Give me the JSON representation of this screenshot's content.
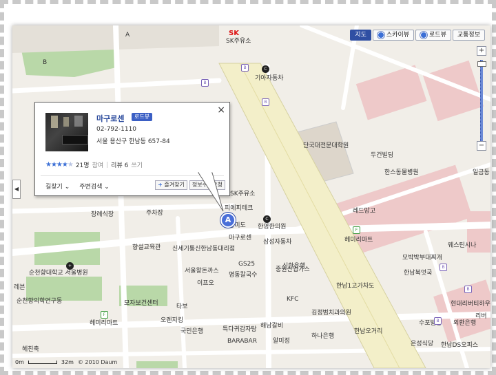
{
  "map_controls": {
    "types": [
      {
        "label": "지도",
        "active": true
      },
      {
        "label": "스카이뷰",
        "active": false
      },
      {
        "label": "로드뷰",
        "active": false
      },
      {
        "label": "교통정보",
        "active": false
      }
    ],
    "zoom_in": "+",
    "zoom_out": "−",
    "collapse": "◀"
  },
  "labels": {
    "sk_brand": "SK",
    "sk_station": "SK주유소",
    "giasa": "기아자동차",
    "dancity": "단국대전문대학원",
    "dugeon": "두건빌딩",
    "hanso": "한스동물병원",
    "ilgeum": "일금동",
    "redmango": "레드망고",
    "hemirimart1": "헤미리마트",
    "wellstina": "웨스틴시나",
    "mobakbag": "모박박부대찌개",
    "hannambook": "한남북엇국",
    "hyundai": "현대리버티하우",
    "riber": "리버",
    "supo": "수포빌딩",
    "oeun": "외환은행",
    "hannamds": "한남DS오피스",
    "eunseong": "은성식당",
    "hannam1": "한남1고가차도",
    "hannamoh": "한남오거리",
    "kimjeong": "김정범치과의원",
    "kfc": "KFC",
    "hanabank": "하나은행",
    "haenam": "해남갈비",
    "almi": "알미정",
    "barabar": "BARABAR",
    "taekwon": "특다귀감자탕",
    "kookmin": "국민은행",
    "ohnsijing": "오렌지킹",
    "tabi": "타보",
    "mojabo": "모자보건센터",
    "hemirimart2": "헤미리마트",
    "suncheon": "순천향대학교 서울병원",
    "suncheon2": "순천향의학연구동",
    "ribbon": "레븐",
    "haechu": "헤친축",
    "changrye": "장례식장",
    "juchajang": "주차장",
    "hyangsul": "향설교육관",
    "singyem": "신세기통신한남동대리점",
    "seoulwang": "서울왕돈까스",
    "ifuk": "이프오",
    "myeongdong": "명동칼국수",
    "gs25": "GS25",
    "shinhan": "신한은행",
    "samseong": "삼성자동차",
    "jungwon": "중원산업가스",
    "hanyoung": "한영한의원",
    "magurosen": "마구로센",
    "sk_station2": "SK주유소",
    "ipi": "피에피테크",
    "hangmi": "항미도",
    "area_a": "A",
    "area_b": "B"
  },
  "info_window": {
    "name": "마구로센",
    "roadview": "로드뷰",
    "phone": "02-792-1110",
    "address": "서울 용산구 한남동 657-84",
    "stars_on": "★★★★",
    "stars_off": "★",
    "reviewers": "21명",
    "rate_link": "참여",
    "review_label": "리뷰 6",
    "review_write": "쓰기",
    "close": "×",
    "nav_find": "길찾기",
    "nearby": "주변검색",
    "fav_btn": "즐겨찾기",
    "fix_btn": "정보수정요청"
  },
  "marker": "A",
  "scale": {
    "left": "0m",
    "right": "32m",
    "copyright": "© 2010 Daum"
  },
  "colors": {
    "road": "#ffffff",
    "block": "#e8e4dc",
    "pink": "#eec7c7",
    "green": "#b9d8a8",
    "highway": "#f4f0c8",
    "accent": "#3b5fc4"
  }
}
